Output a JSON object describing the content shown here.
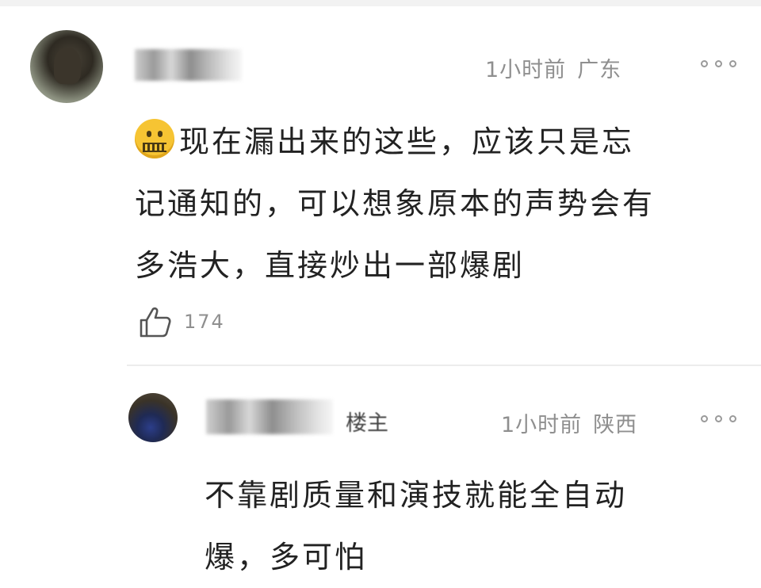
{
  "comments": [
    {
      "time": "1小时前",
      "location": "广东",
      "lines": [
        "现在漏出来的这些，应该只是忘",
        "记通知的，可以想象原本的声势会有",
        "多浩大，直接炒出一部爆剧"
      ],
      "emoji": "zipper-mouth-face",
      "likes": "174"
    },
    {
      "badge": "楼主",
      "time": "1小时前",
      "location": "陕西",
      "lines": [
        "不靠剧质量和演技就能全自动",
        "爆，多可怕"
      ]
    }
  ],
  "colors": {
    "meta_text": "#8f8f8f",
    "body_text": "#222222",
    "divider": "#ececec"
  },
  "icons": [
    "more-icon",
    "like-icon",
    "zipper-mouth-emoji"
  ]
}
